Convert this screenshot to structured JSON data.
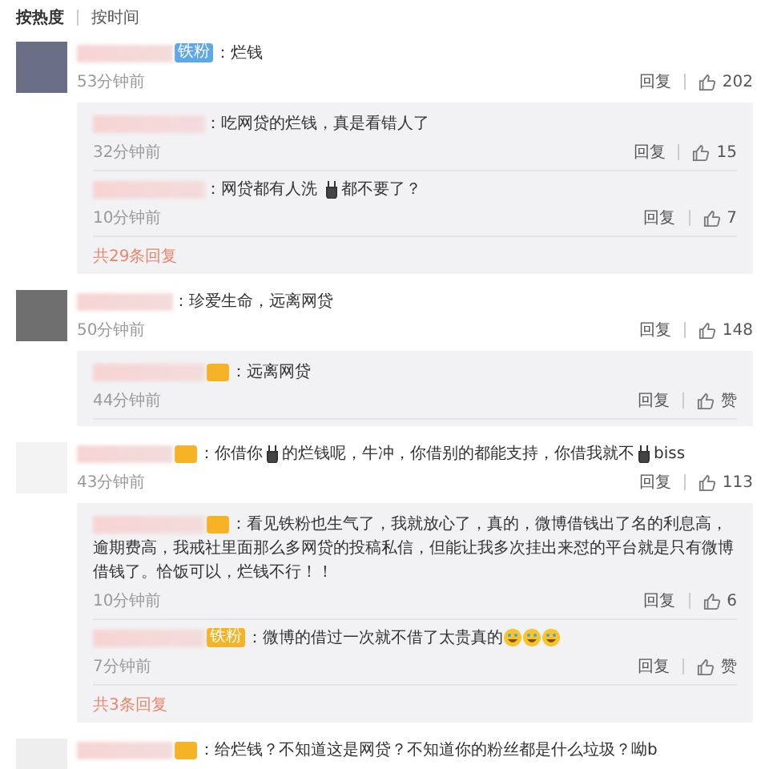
{
  "sort_tabs": [
    {
      "label": "按热度",
      "selected": true
    },
    {
      "label": "按时间",
      "selected": false
    }
  ],
  "comments": [
    {
      "avatar": {
        "kind": "cat"
      },
      "badge": {
        "label": "铁粉",
        "color": "#5fa8e8"
      },
      "segments": [
        {
          "kind": "text",
          "text": "：烂钱"
        }
      ],
      "time": "53分钟前",
      "reply_label": "回复",
      "likes": "202",
      "replies": [
        {
          "segments": [
            {
              "kind": "text",
              "text": "：吃网贷的烂钱，真是看错人了"
            }
          ],
          "time": "32分钟前",
          "reply_label": "回复",
          "likes": "15"
        },
        {
          "segments": [
            {
              "kind": "text",
              "text": "：网贷都有人洗 "
            },
            {
              "kind": "bunny"
            },
            {
              "kind": "text",
              "text": "都不要了？"
            }
          ],
          "time": "10分钟前",
          "reply_label": "回复",
          "likes": "7"
        }
      ],
      "more": "共29条回复"
    },
    {
      "avatar": {
        "kind": "photo"
      },
      "segments": [
        {
          "kind": "text",
          "text": "：珍爱生命，远离网贷"
        }
      ],
      "time": "50分钟前",
      "reply_label": "回复",
      "likes": "148",
      "replies": [
        {
          "badge": {
            "color": "#f5b325"
          },
          "segments": [
            {
              "kind": "text",
              "text": "：远离网贷"
            }
          ],
          "time": "44分钟前",
          "reply_label": "回复",
          "likes": "赞"
        }
      ]
    },
    {
      "avatar": {
        "kind": "logo"
      },
      "badge": {
        "color": "#f5b325"
      },
      "segments": [
        {
          "kind": "text",
          "text": "：你借你"
        },
        {
          "kind": "bunny"
        },
        {
          "kind": "text",
          "text": "的烂钱呢，牛冲，你借别的都能支持，你借我就不"
        },
        {
          "kind": "bunny"
        },
        {
          "kind": "text",
          "text": "biss"
        }
      ],
      "time": "43分钟前",
      "reply_label": "回复",
      "likes": "113",
      "replies": [
        {
          "badge": {
            "color": "#f5b325"
          },
          "segments": [
            {
              "kind": "text",
              "text": "：看见铁粉也生气了，我就放心了，真的，微博借钱出了名的利息高，逾期费高，我戒社里面那么多网贷的投稿私信，但能让我多次挂出来怼的平台就是只有微博借钱了。恰饭可以，烂钱不行！！"
            }
          ],
          "time": "10分钟前",
          "reply_label": "回复",
          "likes": "6"
        },
        {
          "badge": {
            "label": "铁粉",
            "color": "#f5b325"
          },
          "segments": [
            {
              "kind": "text",
              "text": "：微博的借过一次就不借了太贵真的"
            },
            {
              "kind": "laugh"
            },
            {
              "kind": "laugh"
            },
            {
              "kind": "laugh"
            }
          ],
          "time": "7分钟前",
          "reply_label": "回复",
          "likes": "赞"
        }
      ],
      "more": "共3条回复"
    },
    {
      "avatar": {
        "kind": "blank"
      },
      "badge": {
        "color": "#f5b325"
      },
      "segments": [
        {
          "kind": "text",
          "text": "：给烂钱？不知道这是网贷？不知道你的粉丝都是什么垃圾？呦b"
        }
      ]
    }
  ]
}
